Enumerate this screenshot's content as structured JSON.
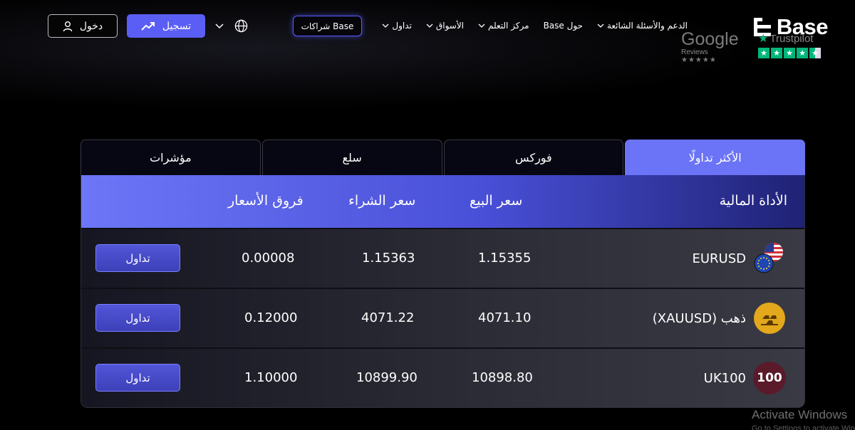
{
  "header": {
    "logo_text": "Base",
    "google_word": "Google",
    "google_sub": "Reviews",
    "google_stars": "★★★★★",
    "trustpilot_word": "Trustpilot",
    "nav": [
      {
        "label": "تداول",
        "has_dropdown": true
      },
      {
        "label": "الأسواق",
        "has_dropdown": true
      },
      {
        "label": "مركز التعلم",
        "has_dropdown": true
      },
      {
        "label": "حول Base",
        "has_dropdown": false
      },
      {
        "label": "الدعم والأسئلة الشائعة",
        "has_dropdown": true
      }
    ],
    "partners_label": "شراكات Base",
    "register_label": "تسجيل",
    "login_label": "دخول"
  },
  "tabs": [
    {
      "label": "الأكثر تداولًا",
      "active": true
    },
    {
      "label": "فوركس",
      "active": false
    },
    {
      "label": "سلع",
      "active": false
    },
    {
      "label": "مؤشرات",
      "active": false
    }
  ],
  "table": {
    "columns": {
      "instrument": "الأداة المالية",
      "sell": "سعر البيع",
      "buy": "سعر الشراء",
      "spread": "فروق الأسعار"
    },
    "rows": [
      {
        "instrument": "EURUSD",
        "icon": "eur-usd-flags-icon",
        "sell": "1.15355",
        "buy": "1.15363",
        "spread": "0.00008",
        "action": "تداول"
      },
      {
        "instrument": "ذهب (XAUUSD)",
        "icon": "gold-bars-icon",
        "sell": "4071.10",
        "buy": "4071.22",
        "spread": "0.12000",
        "action": "تداول"
      },
      {
        "instrument": "UK100",
        "icon": "uk100-badge-icon",
        "badge_text": "100",
        "sell": "10898.80",
        "buy": "10899.90",
        "spread": "1.10000",
        "action": "تداول"
      }
    ]
  },
  "watermark": {
    "line1": "Activate Windows",
    "line2": "Go to Settings to activate Windows."
  },
  "colors": {
    "accent": "#5b5ef5",
    "tab_active": "#6b74f6",
    "trustpilot_green": "#00b67a",
    "gold": "#e3a81c",
    "uk100_badge": "#5a1a2a"
  }
}
